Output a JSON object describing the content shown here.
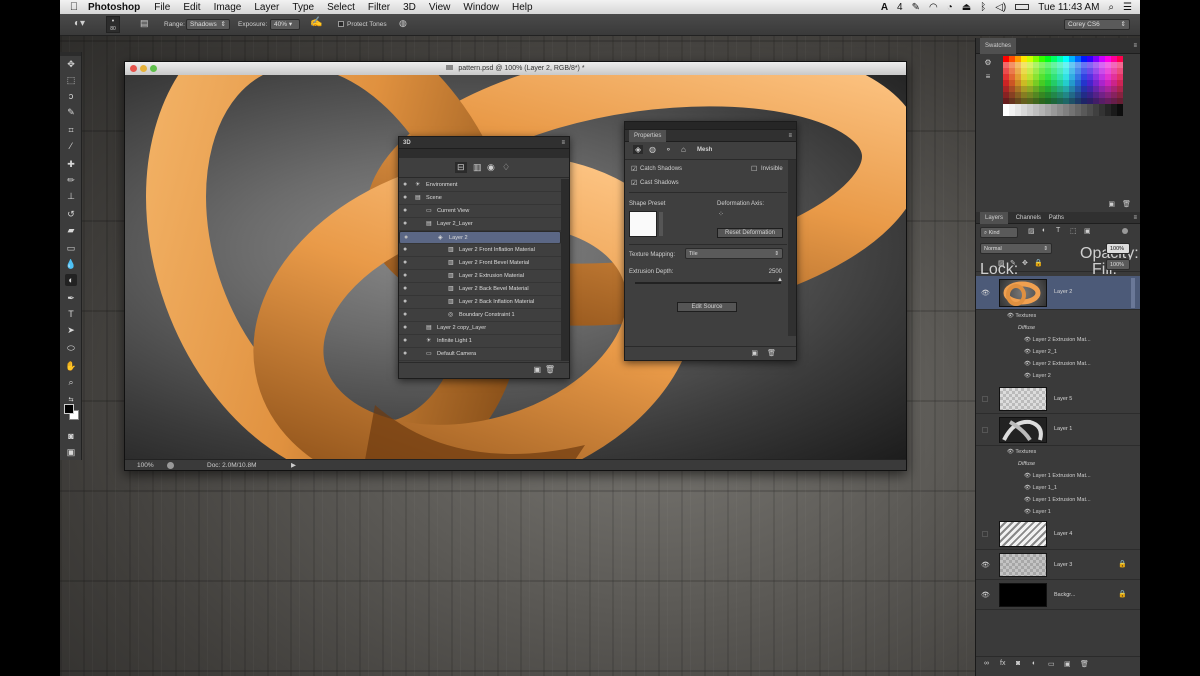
{
  "menubar": {
    "app": "Photoshop",
    "items": [
      "File",
      "Edit",
      "Image",
      "Layer",
      "Type",
      "Select",
      "Filter",
      "3D",
      "View",
      "Window",
      "Help"
    ],
    "status": {
      "badge": "4",
      "clock": "Tue 11:43 AM"
    }
  },
  "options": {
    "brush_size": "80",
    "range_label": "Range:",
    "range_value": "Shadows",
    "exposure_label": "Exposure:",
    "exposure_value": "40%",
    "protect_tones": "Protect Tones",
    "workspace": "Corey CS6"
  },
  "document": {
    "title": "pattern.psd @ 100% (Layer 2, RGB/8*) *",
    "zoom": "100%",
    "doc_info": "Doc: 2.0M/10.8M"
  },
  "panel3d": {
    "tab": "3D",
    "rows": [
      {
        "label": "Environment",
        "depth": 0,
        "eye": true
      },
      {
        "label": "Scene",
        "depth": 0,
        "eye": true
      },
      {
        "label": "Current View",
        "depth": 1,
        "eye": true
      },
      {
        "label": "Layer 2_Layer",
        "depth": 1,
        "eye": true
      },
      {
        "label": "Layer 2",
        "depth": 2,
        "eye": true,
        "selected": true
      },
      {
        "label": "Layer 2 Front Inflation Material",
        "depth": 3,
        "eye": true
      },
      {
        "label": "Layer 2 Front Bevel Material",
        "depth": 3,
        "eye": true
      },
      {
        "label": "Layer 2 Extrusion Material",
        "depth": 3,
        "eye": true
      },
      {
        "label": "Layer 2 Back Bevel Material",
        "depth": 3,
        "eye": true
      },
      {
        "label": "Layer 2 Back Inflation Material",
        "depth": 3,
        "eye": true
      },
      {
        "label": "Boundary Constraint 1",
        "depth": 3,
        "eye": true
      },
      {
        "label": "Layer 2 copy_Layer",
        "depth": 1,
        "eye": true
      },
      {
        "label": "Infinite Light 1",
        "depth": 1,
        "eye": true
      },
      {
        "label": "Default Camera",
        "depth": 1,
        "eye": true
      }
    ]
  },
  "properties": {
    "tab": "Properties",
    "mode": "Mesh",
    "catch_shadows": "Catch Shadows",
    "invisible": "Invisible",
    "cast_shadows": "Cast Shadows",
    "shape_preset": "Shape Preset",
    "deformation_axis": "Deformation Axis:",
    "reset_deformation": "Reset Deformation",
    "texture_mapping_label": "Texture Mapping:",
    "texture_mapping_value": "Tile",
    "extrusion_depth_label": "Extrusion Depth:",
    "extrusion_depth_value": "2500",
    "edit_source": "Edit Source"
  },
  "swatches": {
    "tab": "Swatches"
  },
  "layers_panel": {
    "tabs": [
      "Layers",
      "Channels",
      "Paths"
    ],
    "kind": "Kind",
    "blend_mode": "Normal",
    "opacity_label": "Opacity:",
    "opacity_value": "100%",
    "lock_label": "Lock:",
    "fill_label": "Fill:",
    "fill_value": "100%",
    "layer2": {
      "name": "Layer 2",
      "textures": "Textures",
      "diffuse": "Diffuse",
      "subs": [
        "Layer 2 Extrusion Mat...",
        "Layer 2_1",
        "Layer 2 Extrusion Mat...",
        "Layer 2"
      ]
    },
    "layer5": "Layer 5",
    "layer1": {
      "name": "Layer 1",
      "textures": "Textures",
      "diffuse": "Diffuse",
      "subs": [
        "Layer 1 Extrusion Mat...",
        "Layer 1_1",
        "Layer 1 Extrusion Mat...",
        "Layer 1"
      ]
    },
    "layer4": "Layer 4",
    "layer3": "Layer 3",
    "background": "Backgr..."
  }
}
